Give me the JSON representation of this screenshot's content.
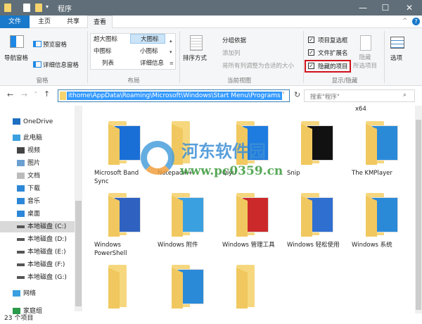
{
  "window": {
    "title": "程序",
    "minimize": "—",
    "maximize": "☐",
    "close": "✕"
  },
  "tabs": [
    {
      "label": "文件"
    },
    {
      "label": "主页"
    },
    {
      "label": "共享"
    },
    {
      "label": "查看"
    }
  ],
  "ribbon": {
    "panes": {
      "nav_pane": "导航窗格",
      "preview_pane": "预览窗格",
      "details_pane": "详细信息窗格",
      "group": "窗格"
    },
    "layout": {
      "items": [
        "超大图标",
        "大图标",
        "中图标",
        "小图标",
        "列表",
        "详细信息"
      ],
      "selected": "大图标",
      "group": "布局"
    },
    "current_view": {
      "sort": "排序方式",
      "group_by": "分组依据",
      "add_column": "添加列",
      "fit_columns": "将所有列调整为合适的大小",
      "group": "当前视图"
    },
    "show_hide": {
      "checkboxes": [
        {
          "label": "项目复选框",
          "checked": true
        },
        {
          "label": "文件扩展名",
          "checked": true
        },
        {
          "label": "隐藏的项目",
          "checked": true
        }
      ],
      "hide_selected": "隐藏\n所选项目",
      "group": "显示/隐藏"
    },
    "options": "选项",
    "highlight_color": "#d0121b"
  },
  "address": {
    "path": "ithome\\AppData\\Roaming\\Microsoft\\Windows\\Start Menu\\Programs",
    "search_placeholder": "搜索\"程序\""
  },
  "sidebar": {
    "items": [
      {
        "label": "OneDrive",
        "icon": "cloud-icon"
      },
      {
        "label": "此电脑",
        "icon": "computer-icon"
      },
      {
        "label": "视频",
        "icon": "video-icon"
      },
      {
        "label": "图片",
        "icon": "picture-icon"
      },
      {
        "label": "文档",
        "icon": "document-icon"
      },
      {
        "label": "下载",
        "icon": "download-icon"
      },
      {
        "label": "音乐",
        "icon": "music-icon"
      },
      {
        "label": "桌面",
        "icon": "desktop-icon"
      },
      {
        "label": "本地磁盘 (C:)",
        "icon": "drive-icon",
        "selected": true
      },
      {
        "label": "本地磁盘 (D:)",
        "icon": "drive-icon"
      },
      {
        "label": "本地磁盘 (E:)",
        "icon": "drive-icon"
      },
      {
        "label": "本地磁盘 (F:)",
        "icon": "drive-icon"
      },
      {
        "label": "本地磁盘 (G:)",
        "icon": "drive-icon"
      },
      {
        "label": "网络",
        "icon": "network-icon"
      },
      {
        "label": "家庭组",
        "icon": "homegroup-icon"
      }
    ]
  },
  "content": {
    "top_label": "x64",
    "items": [
      {
        "label": "Microsoft Band Sync",
        "color": "#1a6fd6"
      },
      {
        "label": "Notepad++",
        "color": ""
      },
      {
        "label": "Qiyu",
        "color": "#1e7be0"
      },
      {
        "label": "Snip",
        "color": "#111111"
      },
      {
        "label": "The KMPlayer",
        "color": "#2a8ad8"
      },
      {
        "label": "Windows PowerShell",
        "color": "#2f62c0"
      },
      {
        "label": "Windows 附件",
        "color": "#3aa0e0"
      },
      {
        "label": "Windows 管理工具",
        "color": "#cc2a2a"
      },
      {
        "label": "Windows 轻松使用",
        "color": "#2f6fd0"
      },
      {
        "label": "Windows 系统",
        "color": "#2a8ad8"
      },
      {
        "label": "",
        "color": ""
      },
      {
        "label": "",
        "color": "#2a8ad8"
      },
      {
        "label": "",
        "color": ""
      }
    ]
  },
  "watermark": {
    "name": "河东软件园",
    "url": "www.pc0359.cn"
  },
  "status": {
    "count": "23 个项目"
  }
}
